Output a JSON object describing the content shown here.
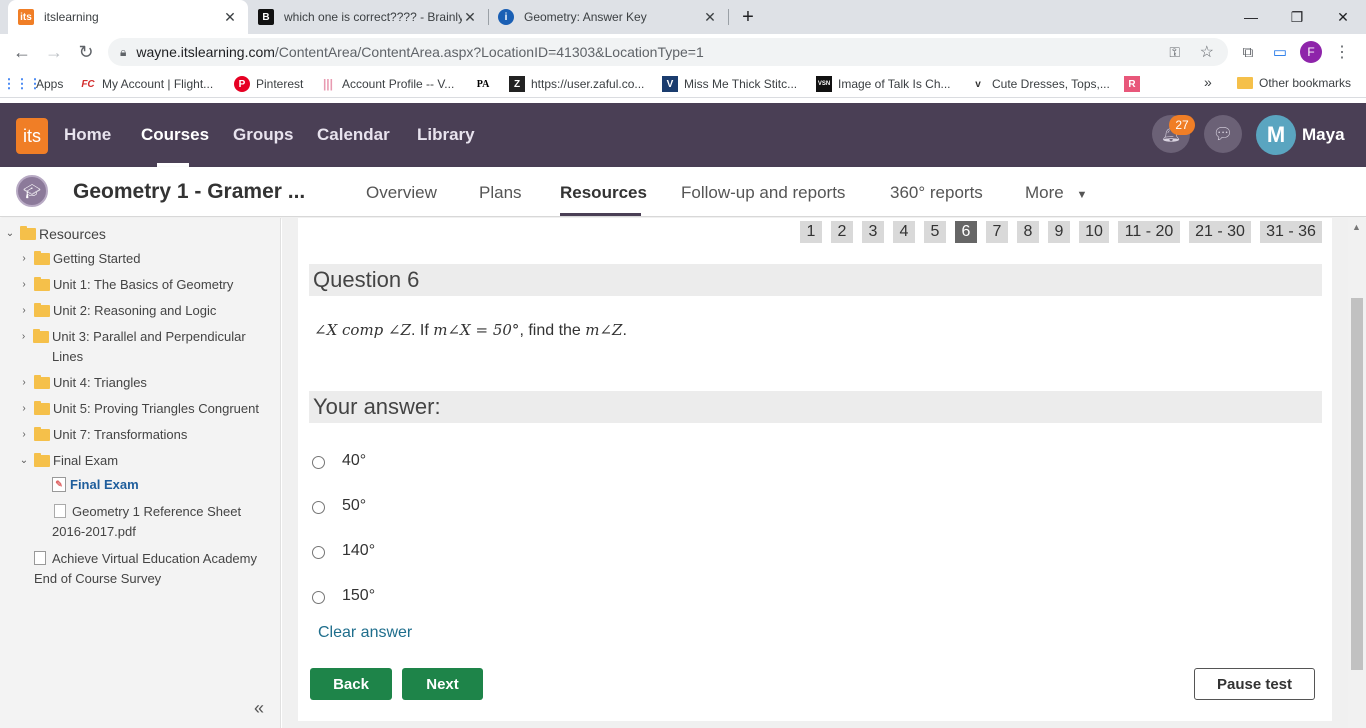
{
  "browser": {
    "tabs": [
      {
        "title": "itslearning",
        "favicon": "its"
      },
      {
        "title": "which one is correct???? - Brainly",
        "favicon": "B"
      },
      {
        "title": "Geometry: Answer Key",
        "favicon": "i"
      }
    ],
    "new_tab": "+",
    "window": {
      "minimize": "—",
      "maximize": "❐",
      "close": "✕"
    },
    "address": {
      "host": "wayne.itslearning.com",
      "path": "/ContentArea/ContentArea.aspx?LocationID=41303&LocationType=1"
    },
    "profile_initial": "F",
    "bookmarks": [
      {
        "label": "Apps",
        "icon": "apps-grid-icon"
      },
      {
        "label": "My Account | Flight...",
        "icon": "FC"
      },
      {
        "label": "Pinterest",
        "icon": "P"
      },
      {
        "label": "Account Profile -- V...",
        "icon": "|||"
      },
      {
        "label": "",
        "icon": "PA"
      },
      {
        "label": "https://user.zaful.co...",
        "icon": "Z"
      },
      {
        "label": "Miss Me Thick Stitc...",
        "icon": "V"
      },
      {
        "label": "Image of Talk Is Ch...",
        "icon": "VSN"
      },
      {
        "label": "Cute Dresses, Tops,...",
        "icon": "v"
      },
      {
        "label": "",
        "icon": "R"
      }
    ],
    "bookmarks_overflow": "»",
    "other_bookmarks": "Other bookmarks"
  },
  "app": {
    "logo": "its",
    "nav": [
      "Home",
      "Courses",
      "Groups",
      "Calendar",
      "Library"
    ],
    "notification_count": "27",
    "user_initial": "M",
    "user_name": "Maya"
  },
  "course": {
    "title": "Geometry 1 - Gramer ...",
    "tabs": [
      "Overview",
      "Plans",
      "Resources",
      "Follow-up and reports",
      "360° reports",
      "More"
    ],
    "more_caret": "▼"
  },
  "sidebar": {
    "root": "Resources",
    "items": [
      {
        "label": "Getting Started"
      },
      {
        "label": "Unit 1: The Basics of Geometry"
      },
      {
        "label": "Unit 2: Reasoning and Logic"
      },
      {
        "label": "Unit 3: Parallel and Perpendicular Lines"
      },
      {
        "label": "Unit 4: Triangles"
      },
      {
        "label": "Unit 5: Proving Triangles Congruent"
      },
      {
        "label": "Unit 7: Transformations"
      },
      {
        "label": "Final Exam"
      }
    ],
    "final_exam_children": [
      {
        "label": "Final Exam"
      },
      {
        "label": "Geometry 1 Reference Sheet 2016-2017.pdf"
      }
    ],
    "survey": "Achieve Virtual Education Academy End of Course Survey",
    "collapse": "«"
  },
  "test": {
    "pages": [
      "1",
      "2",
      "3",
      "4",
      "5",
      "6",
      "7",
      "8",
      "9",
      "10",
      "11 - 20",
      "21 - 30",
      "31 - 36"
    ],
    "current_page": "6",
    "question_title": "Question 6",
    "question": {
      "angle_x_comp_z": "∠X comp ∠Z",
      "if_text": ". If ",
      "m_angle_x_eq": "m∠X = 50°",
      "find_text": ", find the ",
      "m_angle_z": "m∠Z",
      "end": "."
    },
    "answer_title": "Your answer:",
    "options": [
      "40°",
      "50°",
      "140°",
      "150°"
    ],
    "selected_option": null,
    "clear_answer": "Clear answer",
    "back": "Back",
    "next": "Next",
    "pause": "Pause test"
  }
}
